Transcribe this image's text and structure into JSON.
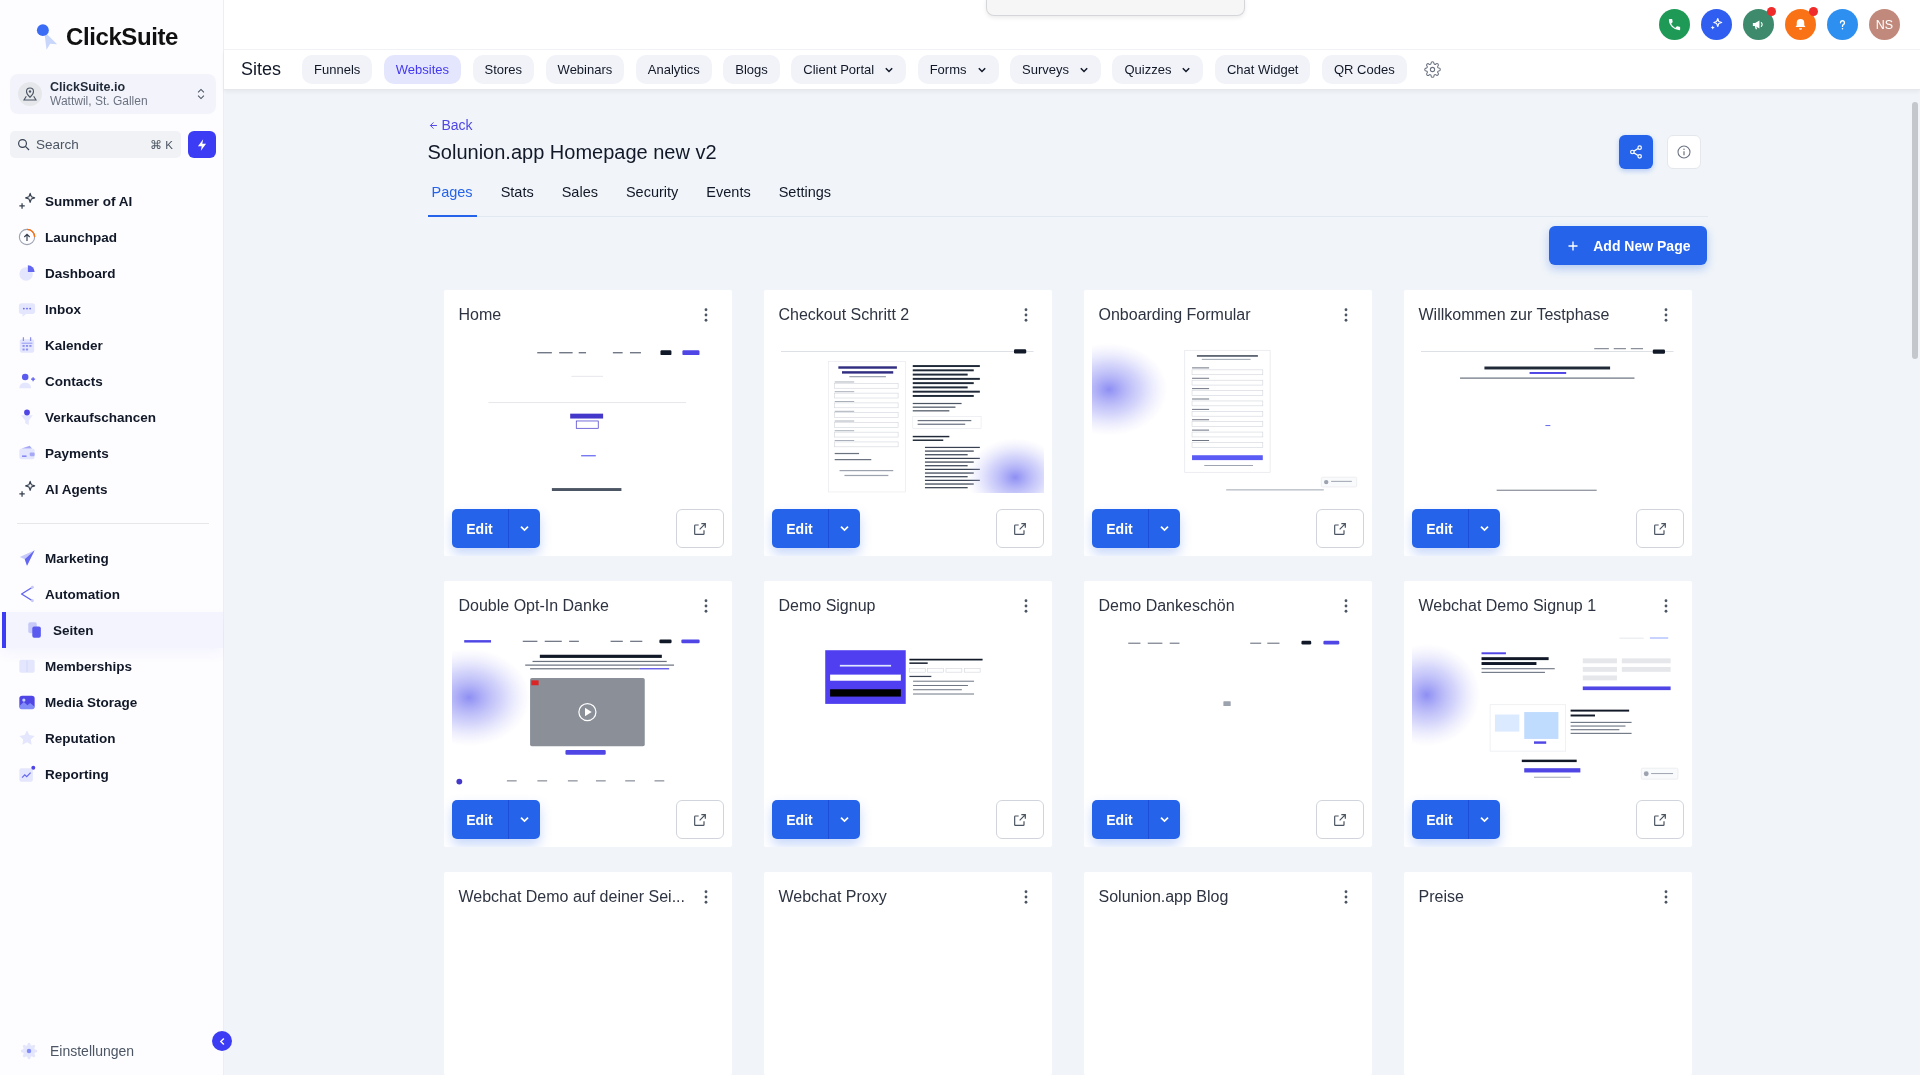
{
  "sidebar": {
    "logo": "ClickSuite",
    "account": {
      "name": "ClickSuite.io",
      "location": "Wattwil, St. Gallen"
    },
    "search": {
      "placeholder": "Search",
      "shortcut": "⌘ K"
    },
    "main_items": [
      {
        "label": "Summer of AI",
        "selected": false
      },
      {
        "label": "Launchpad",
        "selected": false
      },
      {
        "label": "Dashboard",
        "selected": false
      },
      {
        "label": "Inbox",
        "selected": false
      },
      {
        "label": "Kalender",
        "selected": false
      },
      {
        "label": "Contacts",
        "selected": false
      },
      {
        "label": "Verkaufschancen",
        "selected": false
      },
      {
        "label": "Payments",
        "selected": false
      },
      {
        "label": "AI Agents",
        "selected": false
      }
    ],
    "app_items": [
      {
        "label": "Marketing",
        "selected": false
      },
      {
        "label": "Automation",
        "selected": false
      },
      {
        "label": "Seiten",
        "selected": true
      },
      {
        "label": "Memberships",
        "selected": false
      },
      {
        "label": "Media Storage",
        "selected": false
      },
      {
        "label": "Reputation",
        "selected": false
      },
      {
        "label": "Reporting",
        "selected": false
      }
    ],
    "settings": "Einstellungen"
  },
  "topbar": {
    "actions": [
      {
        "notification": false
      },
      {
        "notification": false
      },
      {
        "notification": true
      },
      {
        "notification": true
      },
      {
        "notification": false
      }
    ],
    "user_initials": "NS"
  },
  "section": {
    "title": "Sites",
    "tabs": [
      {
        "label": "Funnels",
        "selected": false,
        "menu": false
      },
      {
        "label": "Websites",
        "selected": true,
        "menu": false
      },
      {
        "label": "Stores",
        "selected": false,
        "menu": false
      },
      {
        "label": "Webinars",
        "selected": false,
        "menu": false
      },
      {
        "label": "Analytics",
        "selected": false,
        "menu": false
      },
      {
        "label": "Blogs",
        "selected": false,
        "menu": false
      },
      {
        "label": "Client Portal",
        "selected": false,
        "menu": true
      },
      {
        "label": "Forms",
        "selected": false,
        "menu": true
      },
      {
        "label": "Surveys",
        "selected": false,
        "menu": true
      },
      {
        "label": "Quizzes",
        "selected": false,
        "menu": true
      },
      {
        "label": "Chat Widget",
        "selected": false,
        "menu": false
      },
      {
        "label": "QR Codes",
        "selected": false,
        "menu": false
      }
    ]
  },
  "site": {
    "back": "Back",
    "title": "Solunion.app Homepage new v2",
    "tabs": [
      {
        "label": "Pages",
        "selected": true
      },
      {
        "label": "Stats",
        "selected": false
      },
      {
        "label": "Sales",
        "selected": false
      },
      {
        "label": "Security",
        "selected": false
      },
      {
        "label": "Events",
        "selected": false
      },
      {
        "label": "Settings",
        "selected": false
      }
    ],
    "add_button": "Add New Page"
  },
  "pages": [
    {
      "title": "Home",
      "kind": "landing",
      "edit": "Edit"
    },
    {
      "title": "Checkout Schritt 2",
      "kind": "checkout",
      "edit": "Edit"
    },
    {
      "title": "Onboarding Formular",
      "kind": "form",
      "edit": "Edit"
    },
    {
      "title": "Willkommen zur Testphase",
      "kind": "welcome",
      "edit": "Edit"
    },
    {
      "title": "Double Opt-In Danke",
      "kind": "video",
      "edit": "Edit"
    },
    {
      "title": "Demo Signup",
      "kind": "signup",
      "edit": "Edit"
    },
    {
      "title": "Demo Dankeschön",
      "kind": "thanks",
      "edit": "Edit"
    },
    {
      "title": "Webchat Demo Signup 1",
      "kind": "webchat",
      "edit": "Edit"
    },
    {
      "title": "Webchat Demo auf deiner Sei..."
    },
    {
      "title": "Webchat Proxy"
    },
    {
      "title": "Solunion.app Blog"
    },
    {
      "title": "Preise"
    }
  ]
}
